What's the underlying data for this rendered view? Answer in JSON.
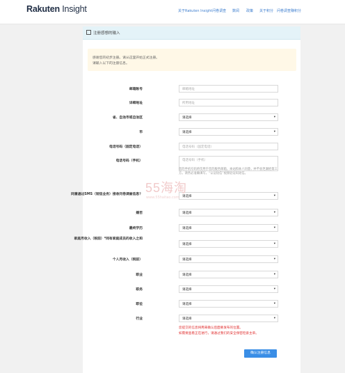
{
  "brand": {
    "name_bold": "Rakuten",
    "name_rest": " Insight"
  },
  "nav": [
    "关于Rakuten Insight问卷调查",
    "数阅",
    "政策",
    "关于积分",
    "问卷调查赚积分"
  ],
  "panel": {
    "title": "注册感想的输入"
  },
  "notice": {
    "lines": [
      "感谢您的初步注册。请从这里开始正式注册。",
      "请输入以下的注册信息。"
    ]
  },
  "fields": [
    {
      "label": "邮箱账号",
      "placeholder": "邮箱地址"
    },
    {
      "label": "详细地址",
      "placeholder": "所用地址"
    },
    {
      "label": "省、自治市或自治区",
      "value": "请选择"
    },
    {
      "label": "市",
      "value": "请选择"
    },
    {
      "label": "电话号码（固定电话）",
      "placeholder": "电话号码（固定电话）"
    },
    {
      "label": "电话号码（手机）",
      "placeholder": "电话号码（手机）"
    }
  ],
  "phone_hint": "您的手机号码将仅用于您的服务邮箱，本站和本人同意，并不会泄漏给第三方，请务必准确填写，“认证短信”视频验证码短信。",
  "selects": [
    {
      "label": "同意通过SMS（短信业务）接收问卷调查信息？",
      "value": "请选择"
    },
    {
      "label": "婚否",
      "value": "请选择"
    },
    {
      "label": "最终学历",
      "value": "请选择"
    },
    {
      "label": "家庭月收入（税前）*同有家庭成员的收入之和",
      "value": "请选择"
    },
    {
      "label": "个人月收入（税前）",
      "value": "请选择"
    },
    {
      "label": "职业",
      "value": "请选择"
    },
    {
      "label": "职务",
      "value": "请选择"
    },
    {
      "label": "职位",
      "value": "请选择"
    },
    {
      "label": "行业",
      "value": "请选择"
    }
  ],
  "warnings": [
    "您提交的信息将用来确认后面要发布的位置。",
    "如需要查看正在进行，请通过我们的安全保密检索主单。"
  ],
  "submit_label": "确认注册信息",
  "watermark": {
    "text": "55海淘",
    "sub": "www.55haitao.com"
  }
}
